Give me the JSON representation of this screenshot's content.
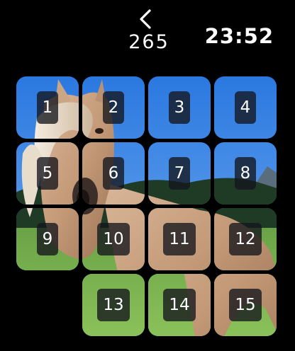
{
  "header": {
    "move_count": "265",
    "time": "23:52"
  },
  "board": {
    "grid": 4,
    "tiles": [
      {
        "label": "1",
        "row": 0,
        "col": 0
      },
      {
        "label": "2",
        "row": 0,
        "col": 1
      },
      {
        "label": "3",
        "row": 0,
        "col": 2
      },
      {
        "label": "4",
        "row": 0,
        "col": 3
      },
      {
        "label": "5",
        "row": 1,
        "col": 0
      },
      {
        "label": "6",
        "row": 1,
        "col": 1
      },
      {
        "label": "7",
        "row": 1,
        "col": 2
      },
      {
        "label": "8",
        "row": 1,
        "col": 3
      },
      {
        "label": "9",
        "row": 2,
        "col": 0
      },
      {
        "label": "10",
        "row": 2,
        "col": 1
      },
      {
        "label": "11",
        "row": 2,
        "col": 2
      },
      {
        "label": "12",
        "row": 2,
        "col": 3
      },
      {
        "label": "13",
        "row": 3,
        "col": 1
      },
      {
        "label": "14",
        "row": 3,
        "col": 2
      },
      {
        "label": "15",
        "row": 3,
        "col": 3
      }
    ],
    "empty_cell": {
      "row": 3,
      "col": 0
    }
  }
}
